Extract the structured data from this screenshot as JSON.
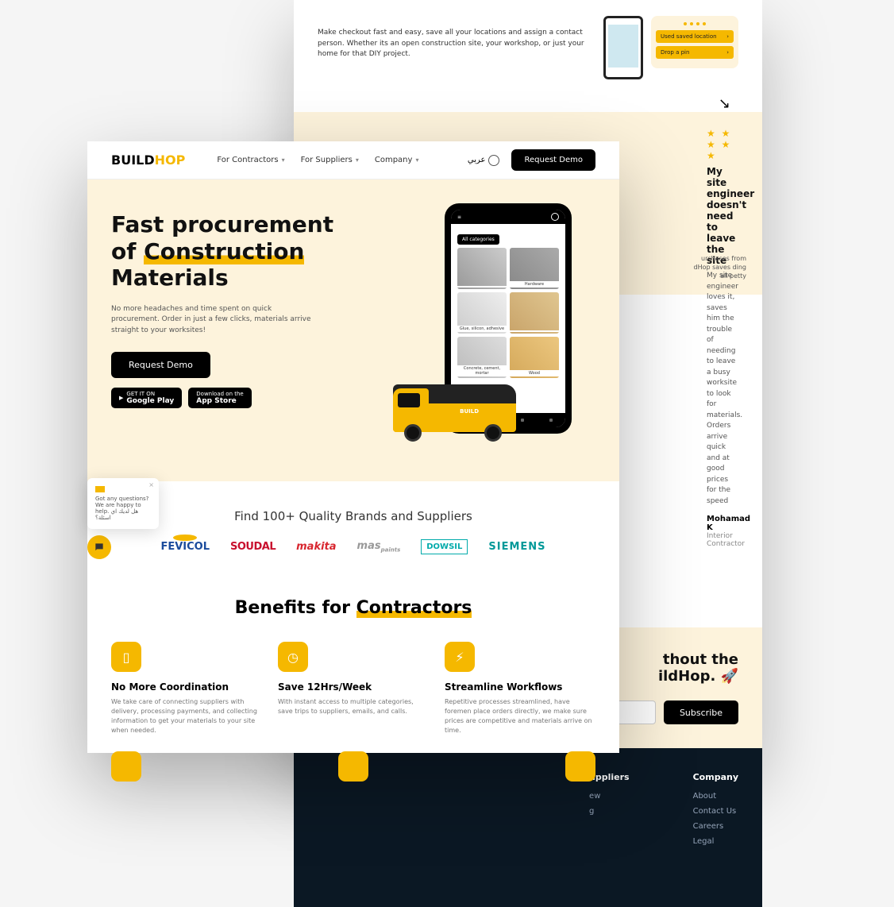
{
  "back": {
    "checkout_text": "Make checkout fast and easy, save all your locations and assign a contact person. Whether its an open construction site, your workshop, or just your home for that DIY project.",
    "loc_btn1": "Used saved location",
    "loc_btn2": "Drop a pin",
    "partial_review": "urchases from dHop saves ding all petty",
    "review": {
      "title": "My site engineer doesn't need to leave the site",
      "body": "My site engineer loves it, saves him the trouble of needing to leave a busy worksite to look for materials. Orders arrive quick and at good prices for the speed",
      "author": "Mohamad K",
      "role": "Interior Contractor"
    },
    "cta_line1": "thout the",
    "cta_line2": "ildHop. 🚀",
    "subscribe": "Subscribe",
    "footer": {
      "col1_title": "uppliers",
      "col1_links": [
        "ew",
        "g"
      ],
      "col2_title": "Company",
      "col2_links": [
        "About",
        "Contact Us",
        "Careers",
        "Legal"
      ]
    }
  },
  "front": {
    "logo_a": "BUILD",
    "logo_b": "HOP",
    "nav": {
      "contractors": "For Contractors",
      "suppliers": "For Suppliers",
      "company": "Company",
      "lang": "عربي"
    },
    "request_demo": "Request Demo",
    "hero": {
      "title_l1": "Fast procurement",
      "title_l2a": "of ",
      "title_l2b": "Construction",
      "title_l3": "Materials",
      "sub": "No more headaches and time spent on quick procurement. Order in just a few clicks, materials arrive straight to your worksites!",
      "cta": "Request Demo",
      "gplay_small": "GET IT ON",
      "gplay": "Google Play",
      "astore_small": "Download on the",
      "astore": "App Store"
    },
    "phone": {
      "all_cat": "All categories",
      "tiles": [
        "",
        "Hardware",
        "Glue, silicon, adhesive",
        "",
        "Concrete, cement, mortar",
        "Wood"
      ]
    },
    "brands": {
      "title": "Find 100+ Quality Brands and Suppliers",
      "list": [
        "FEVICOL",
        "SOUDAL",
        "makita",
        "mas",
        "DOWSIL",
        "SIEMENS"
      ]
    },
    "benefits": {
      "title_a": "Benefits for ",
      "title_b": "Contractors",
      "items": [
        {
          "title": "No More Coordination",
          "desc": "We take care of connecting suppliers with delivery, processing payments, and collecting information to get your materials to your site when needed."
        },
        {
          "title": "Save 12Hrs/Week",
          "desc": "With instant access to multiple categories, save trips to suppliers, emails, and calls."
        },
        {
          "title": "Streamline Workflows",
          "desc": "Repetitive processes streamlined, have foremen place orders directly, we make sure prices are competitive and materials arrive on time."
        }
      ]
    }
  },
  "chat": {
    "msg": "Got any questions? We are happy to help. هل لديك اي اسئلة؟"
  }
}
